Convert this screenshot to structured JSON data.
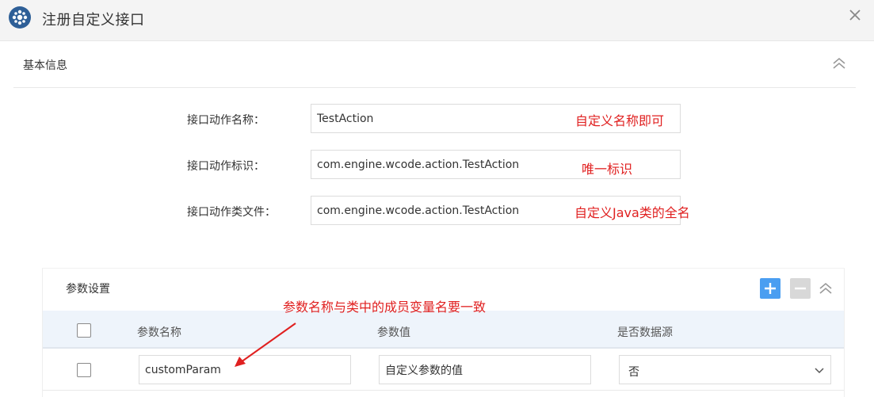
{
  "dialog": {
    "title": "注册自定义接口",
    "icon": "gear-logo-icon",
    "close_icon": "close-icon"
  },
  "basic_info": {
    "title": "基本信息",
    "collapse_icon": "double-chevron-up-icon",
    "fields": [
      {
        "label": "接口动作名称：",
        "value": "TestAction",
        "note": "自定义名称即可"
      },
      {
        "label": "接口动作标识：",
        "value": "com.engine.wcode.action.TestAction",
        "note": "唯一标识"
      },
      {
        "label": "接口动作类文件：",
        "value": "com.engine.wcode.action.TestAction",
        "note": "自定义Java类的全名"
      }
    ]
  },
  "params": {
    "title": "参数设置",
    "add_icon": "plus-icon",
    "remove_icon": "minus-icon",
    "collapse_icon": "double-chevron-up-icon",
    "annotation": "参数名称与类中的成员变量名要一致",
    "columns": [
      "参数名称",
      "参数值",
      "是否数据源"
    ],
    "rows": [
      {
        "name": "customParam",
        "value": "自定义参数的值",
        "is_datasource": "否"
      }
    ]
  },
  "colors": {
    "accent": "#4a9ef1",
    "annotation_red": "#e02020",
    "header_bg": "#eef4fb"
  }
}
